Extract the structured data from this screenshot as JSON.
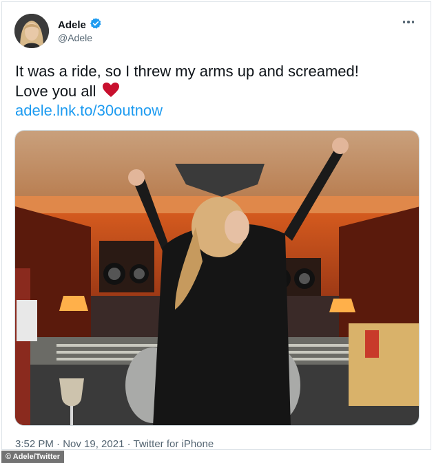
{
  "tweet": {
    "author_name": "Adele",
    "author_handle": "@Adele",
    "text_line1": "It was a ride, so I threw my arms up and screamed!",
    "text_line2": "Love you all",
    "link": "adele.lnk.to/30outnow",
    "timestamp": "3:52 PM · Nov 19, 2021 · Twitter for iPhone"
  },
  "credit": "© Adele/Twitter",
  "icons": {
    "verified": "verified-badge-icon",
    "more": "more-options-icon",
    "heart": "red-heart-emoji"
  },
  "colors": {
    "link": "#1d9bf0",
    "verified": "#1d9bf0",
    "heart": "#c8102e",
    "text": "#0f1419",
    "muted": "#536471"
  }
}
